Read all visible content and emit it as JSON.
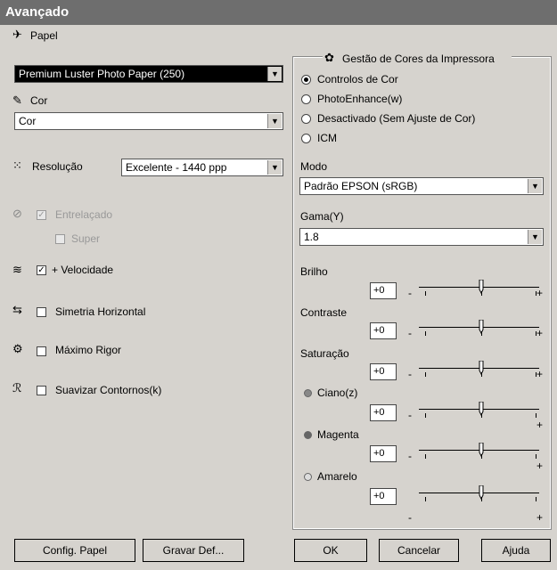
{
  "window": {
    "title": "Avançado"
  },
  "left": {
    "paper_label": "Papel",
    "paper_value": "Premium Luster Photo Paper (250)",
    "color_label": "Cor",
    "color_value": "Cor",
    "resolution_label": "Resolução",
    "resolution_value": "Excelente - 1440 ppp",
    "interlaced_label": "Entrelaçado",
    "super_label": "Super",
    "speed_label": "+ Velocidade",
    "mirror_label": "Simetria Horizontal",
    "max_precision_label": "Máximo Rigor",
    "smooth_label": "Suavizar Contornos(k)"
  },
  "right": {
    "group_title": "Gestão de Cores da Impressora",
    "radio_color_controls": "Controlos de Cor",
    "radio_photoenhance": "PhotoEnhance(w)",
    "radio_off": "Desactivado (Sem Ajuste de Cor)",
    "radio_icm": "ICM",
    "mode_label": "Modo",
    "mode_value": "Padrão EPSON (sRGB)",
    "gamma_label": "Gama(Y)",
    "gamma_value": "1.8",
    "sliders": [
      {
        "label": "Brilho",
        "value": "+0",
        "level": 0
      },
      {
        "label": "Contraste",
        "value": "+0",
        "level": 0
      },
      {
        "label": "Saturação",
        "value": "+0",
        "level": 0
      },
      {
        "label": "Ciano(z)",
        "value": "+0",
        "level": 0
      },
      {
        "label": "Magenta",
        "value": "+0",
        "level": 0
      },
      {
        "label": "Amarelo",
        "value": "+0",
        "level": 0
      }
    ],
    "minus": "-",
    "plus": "+"
  },
  "buttons": {
    "paper_config": "Config. Papel",
    "save_def": "Gravar Def...",
    "ok": "OK",
    "cancel": "Cancelar",
    "help": "Ajuda"
  },
  "colors": {
    "titlebar": "#6e6e6e",
    "dialog": "#d6d3ce",
    "cyan_dot": "#888888",
    "magenta_dot": "#666666",
    "yellow_dot": "#bbbbbb"
  }
}
